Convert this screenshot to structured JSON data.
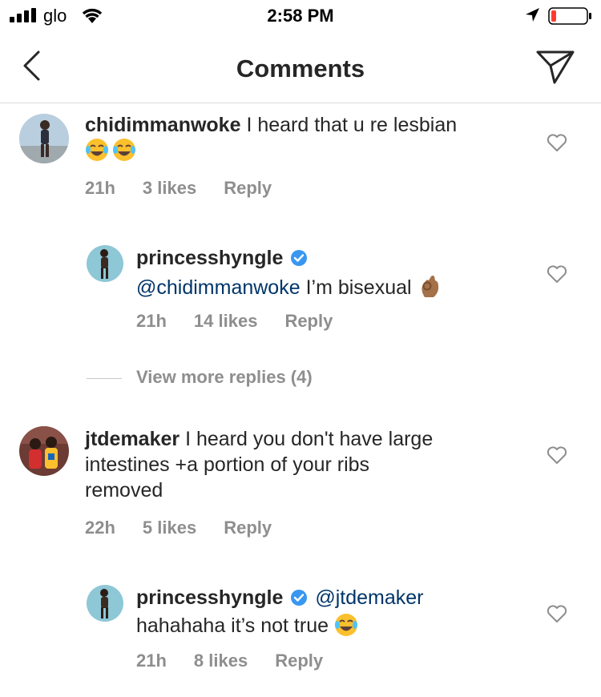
{
  "status_bar": {
    "carrier": "glo",
    "time": "2:58 PM"
  },
  "nav": {
    "title": "Comments"
  },
  "comments": [
    {
      "user": "chidimmanwoke",
      "text": "I heard that u re lesbian",
      "emojis": [
        "face-with-tears-of-joy",
        "face-with-tears-of-joy"
      ],
      "time": "21h",
      "likes": "3 likes",
      "reply": "Reply"
    },
    {
      "user": "princesshyngle",
      "mention": "@chidimmanwoke",
      "text": "I’m bisexual",
      "emojis": [
        "ok-hand"
      ],
      "time": "21h",
      "likes": "14 likes",
      "reply": "Reply"
    },
    {
      "user": "jtdemaker",
      "text_line1": "I heard you don't have large",
      "text_line2": "intestines +a portion of your ribs",
      "text_line3": "removed",
      "time": "22h",
      "likes": "5 likes",
      "reply": "Reply"
    },
    {
      "user": "princesshyngle",
      "mention": "@jtdemaker",
      "text": "hahahaha it’s not true",
      "emojis": [
        "face-with-tears-of-joy"
      ],
      "time": "21h",
      "likes": "8 likes",
      "reply": "Reply"
    }
  ],
  "view_more_replies": "View more replies (4)",
  "colors": {
    "mention": "#003569",
    "meta": "#8e8e8e",
    "verified": "#3897f0",
    "battery_low": "#ff3b30"
  }
}
